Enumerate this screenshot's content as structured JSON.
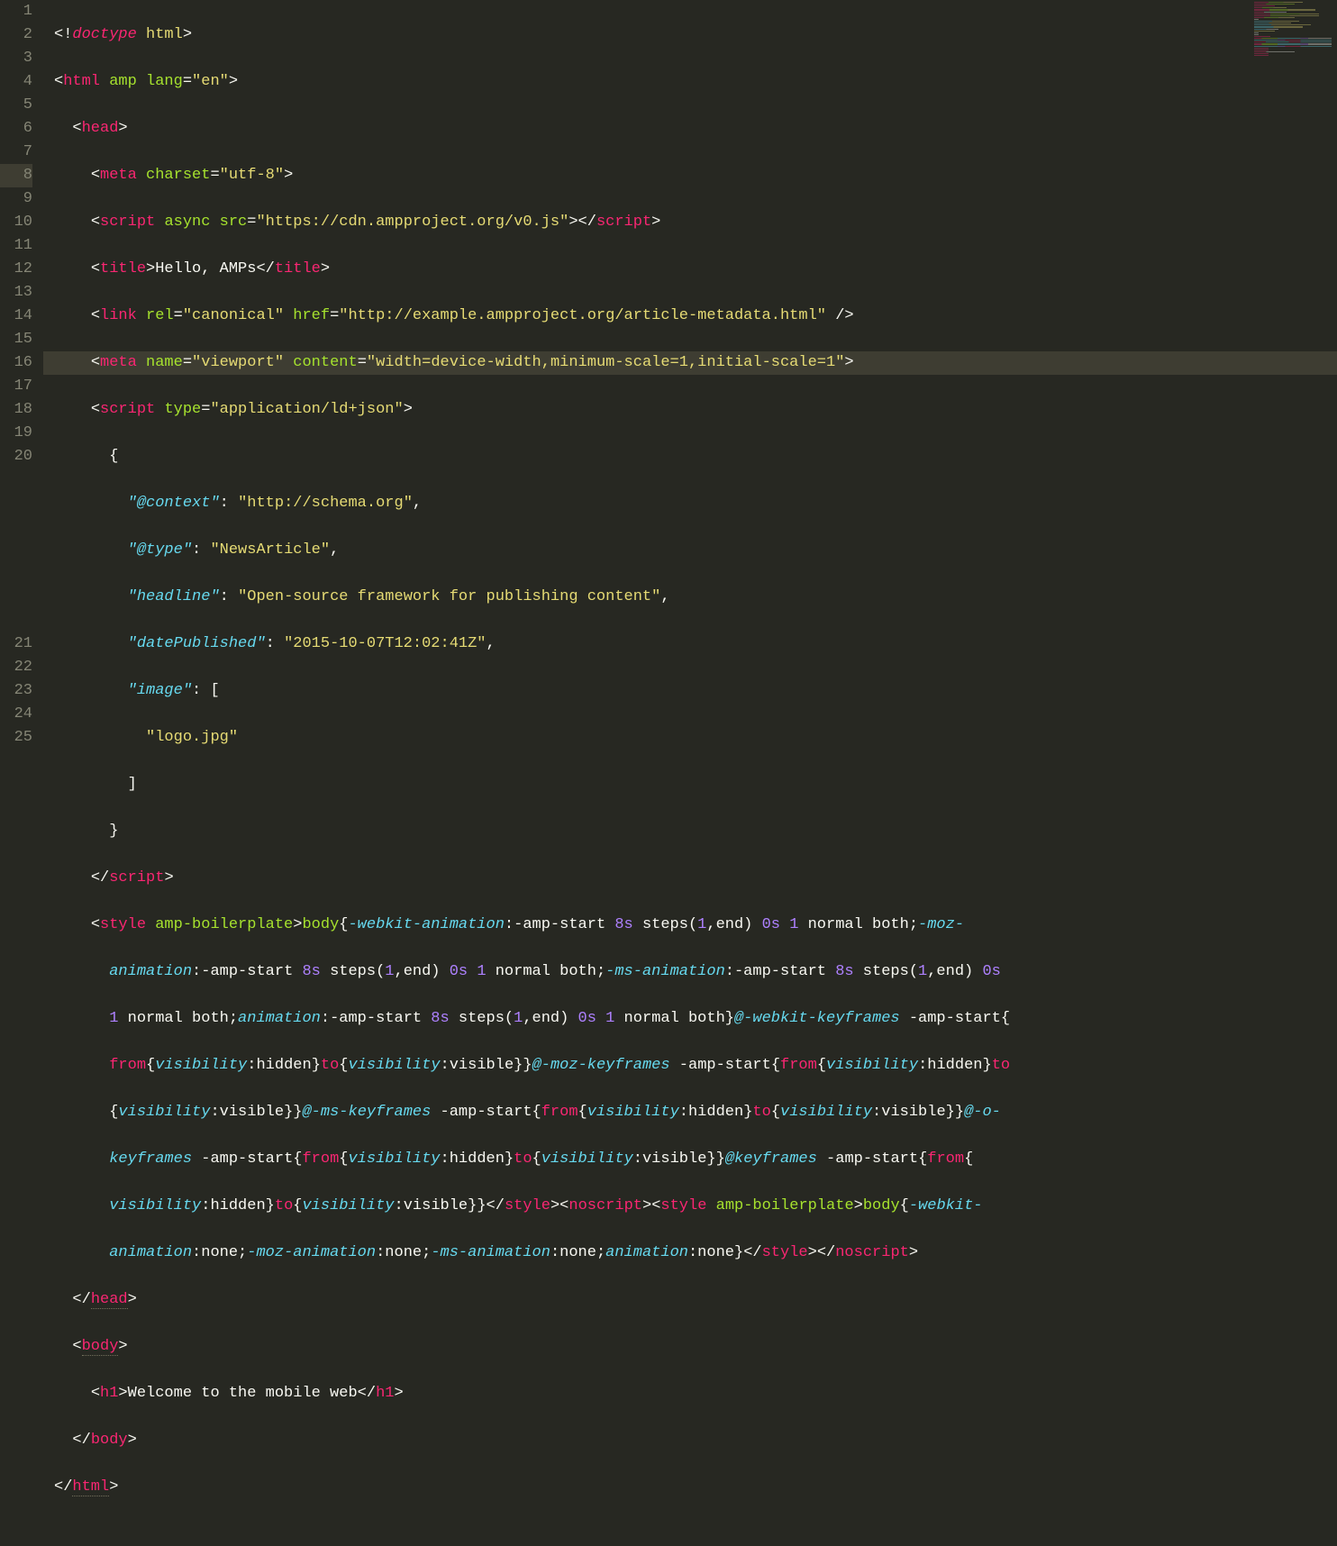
{
  "lines": {
    "count": 25
  },
  "code": {
    "l1": {
      "doctype": "doctype",
      "html": "html"
    },
    "l2": {
      "tag": "html",
      "attr1": "amp",
      "attr2": "lang",
      "val2": "\"en\""
    },
    "l3": {
      "tag": "head"
    },
    "l4": {
      "tag": "meta",
      "attr": "charset",
      "val": "\"utf-8\""
    },
    "l5": {
      "tag": "script",
      "attr1": "async",
      "attr2": "src",
      "val2": "\"https://cdn.ampproject.org/v0.js\"",
      "close": "script"
    },
    "l6": {
      "tag": "title",
      "text": "Hello, AMPs",
      "close": "title"
    },
    "l7": {
      "tag": "link",
      "attr1": "rel",
      "val1": "\"canonical\"",
      "attr2": "href",
      "val2": "\"http://example.ampproject.org/article-metadata.html\""
    },
    "l8": {
      "tag": "meta",
      "attr1": "name",
      "val1": "\"viewport\"",
      "attr2": "content",
      "val2": "\"width=device-width,minimum-scale=1,initial-scale=1\""
    },
    "l9": {
      "tag": "script",
      "attr": "type",
      "val": "\"application/ld+json\""
    },
    "l10": {
      "text": "{"
    },
    "l11": {
      "key": "\"@context\"",
      "val": "\"http://schema.org\""
    },
    "l12": {
      "key": "\"@type\"",
      "val": "\"NewsArticle\""
    },
    "l13": {
      "key": "\"headline\"",
      "val": "\"Open-source framework for publishing content\""
    },
    "l14": {
      "key": "\"datePublished\"",
      "val": "\"2015-10-07T12:02:41Z\""
    },
    "l15": {
      "key": "\"image\"",
      "bracket": "["
    },
    "l16": {
      "val": "\"logo.jpg\""
    },
    "l17": {
      "bracket": "]"
    },
    "l18": {
      "text": "}"
    },
    "l19": {
      "close": "script"
    },
    "l20": {
      "tag_open": "style",
      "attr": "amp-boilerplate",
      "sel_body": "body",
      "p_wa": "-webkit-animation",
      "v_amp": ":-amp-start ",
      "n8": "8s",
      "steps": " steps(",
      "one": "1",
      "end": ",end) ",
      "zero": "0s",
      "sp": " ",
      "one2": "1",
      "nb": " normal both;",
      "p_ma": "-moz-",
      "p_ma2": "animation",
      "p_msa": "-ms-animation",
      "p_an": "animation",
      "at_wk": "@-webkit-keyframes",
      "sel_amp": " -amp-start",
      "from": "from",
      "vis": "visibility",
      "hidden": ":hidden",
      "to": "to",
      "visible": ":visible",
      "at_moz": "@-moz-keyframes",
      "at_ms": "@-ms-keyframes",
      "at_o": "@-o-",
      "kf": "keyframes",
      "at_kf": "@keyframes",
      "close_style": "style",
      "noscript": "noscript",
      "none": ":none;",
      "none2": ":none",
      "semi": ";"
    },
    "l21": {
      "close": "head"
    },
    "l22": {
      "tag": "body"
    },
    "l23": {
      "tag": "h1",
      "text": "Welcome to the mobile web",
      "close": "h1"
    },
    "l24": {
      "close": "body"
    },
    "l25": {
      "close": "html"
    }
  }
}
